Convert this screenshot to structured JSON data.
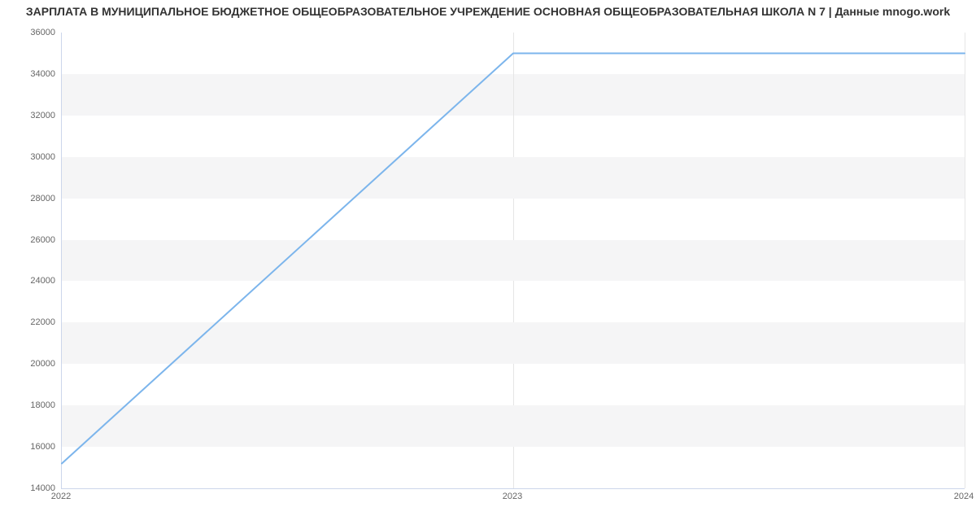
{
  "title": "ЗАРПЛАТА В МУНИЦИПАЛЬНОЕ БЮДЖЕТНОЕ ОБЩЕОБРАЗОВАТЕЛЬНОЕ УЧРЕЖДЕНИЕ ОСНОВНАЯ ОБЩЕОБРАЗОВАТЕЛЬНАЯ ШКОЛА N 7 | Данные mnogo.work",
  "chart_data": {
    "type": "line",
    "title": "ЗАРПЛАТА В МУНИЦИПАЛЬНОЕ БЮДЖЕТНОЕ ОБЩЕОБРАЗОВАТЕЛЬНОЕ УЧРЕЖДЕНИЕ ОСНОВНАЯ ОБЩЕОБРАЗОВАТЕЛЬНАЯ ШКОЛА N 7 | Данные mnogo.work",
    "xlabel": "",
    "ylabel": "",
    "x": [
      2022,
      2023,
      2024
    ],
    "values": [
      15200,
      35000,
      35000
    ],
    "x_ticks": [
      2022,
      2023,
      2024
    ],
    "y_ticks": [
      14000,
      16000,
      18000,
      20000,
      22000,
      24000,
      26000,
      28000,
      30000,
      32000,
      34000,
      36000
    ],
    "xlim": [
      2022,
      2024
    ],
    "ylim": [
      14000,
      36000
    ],
    "series_color": "#7cb5ec",
    "grid": true
  }
}
